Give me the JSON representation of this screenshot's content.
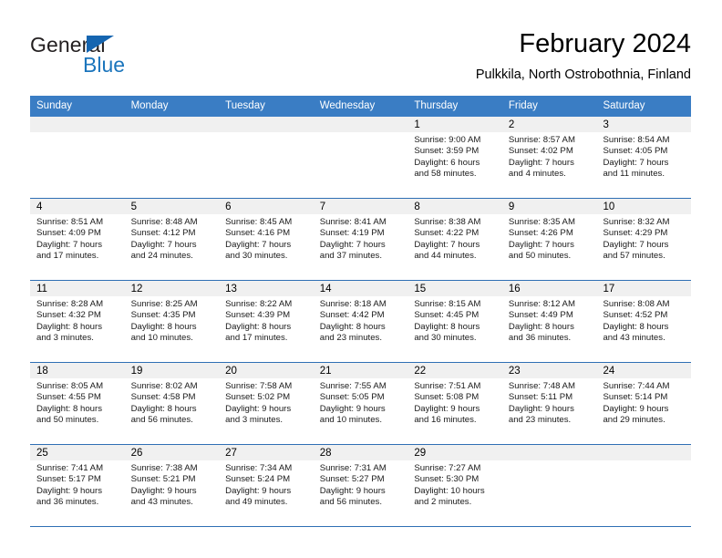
{
  "logo": {
    "word_general": "General",
    "word_blue": "Blue",
    "triangle_color": "#1565b0",
    "blue_color": "#1b75bc"
  },
  "header": {
    "month_title": "February 2024",
    "location": "Pulkkila, North Ostrobothnia, Finland"
  },
  "theme": {
    "header_row_bg": "#3a7dc4",
    "row_divider": "#2f6fb4",
    "daynum_band_bg": "#f0f0f0",
    "page_bg": "#ffffff",
    "text": "#000000"
  },
  "calendar": {
    "weekdays": [
      "Sunday",
      "Monday",
      "Tuesday",
      "Wednesday",
      "Thursday",
      "Friday",
      "Saturday"
    ],
    "weeks": [
      [
        {
          "day": "",
          "empty": true,
          "sunrise": "",
          "sunset": "",
          "daylight1": "",
          "daylight2": ""
        },
        {
          "day": "",
          "empty": true,
          "sunrise": "",
          "sunset": "",
          "daylight1": "",
          "daylight2": ""
        },
        {
          "day": "",
          "empty": true,
          "sunrise": "",
          "sunset": "",
          "daylight1": "",
          "daylight2": ""
        },
        {
          "day": "",
          "empty": true,
          "sunrise": "",
          "sunset": "",
          "daylight1": "",
          "daylight2": ""
        },
        {
          "day": "1",
          "sunrise": "Sunrise: 9:00 AM",
          "sunset": "Sunset: 3:59 PM",
          "daylight1": "Daylight: 6 hours",
          "daylight2": "and 58 minutes."
        },
        {
          "day": "2",
          "sunrise": "Sunrise: 8:57 AM",
          "sunset": "Sunset: 4:02 PM",
          "daylight1": "Daylight: 7 hours",
          "daylight2": "and 4 minutes."
        },
        {
          "day": "3",
          "sunrise": "Sunrise: 8:54 AM",
          "sunset": "Sunset: 4:05 PM",
          "daylight1": "Daylight: 7 hours",
          "daylight2": "and 11 minutes."
        }
      ],
      [
        {
          "day": "4",
          "sunrise": "Sunrise: 8:51 AM",
          "sunset": "Sunset: 4:09 PM",
          "daylight1": "Daylight: 7 hours",
          "daylight2": "and 17 minutes."
        },
        {
          "day": "5",
          "sunrise": "Sunrise: 8:48 AM",
          "sunset": "Sunset: 4:12 PM",
          "daylight1": "Daylight: 7 hours",
          "daylight2": "and 24 minutes."
        },
        {
          "day": "6",
          "sunrise": "Sunrise: 8:45 AM",
          "sunset": "Sunset: 4:16 PM",
          "daylight1": "Daylight: 7 hours",
          "daylight2": "and 30 minutes."
        },
        {
          "day": "7",
          "sunrise": "Sunrise: 8:41 AM",
          "sunset": "Sunset: 4:19 PM",
          "daylight1": "Daylight: 7 hours",
          "daylight2": "and 37 minutes."
        },
        {
          "day": "8",
          "sunrise": "Sunrise: 8:38 AM",
          "sunset": "Sunset: 4:22 PM",
          "daylight1": "Daylight: 7 hours",
          "daylight2": "and 44 minutes."
        },
        {
          "day": "9",
          "sunrise": "Sunrise: 8:35 AM",
          "sunset": "Sunset: 4:26 PM",
          "daylight1": "Daylight: 7 hours",
          "daylight2": "and 50 minutes."
        },
        {
          "day": "10",
          "sunrise": "Sunrise: 8:32 AM",
          "sunset": "Sunset: 4:29 PM",
          "daylight1": "Daylight: 7 hours",
          "daylight2": "and 57 minutes."
        }
      ],
      [
        {
          "day": "11",
          "sunrise": "Sunrise: 8:28 AM",
          "sunset": "Sunset: 4:32 PM",
          "daylight1": "Daylight: 8 hours",
          "daylight2": "and 3 minutes."
        },
        {
          "day": "12",
          "sunrise": "Sunrise: 8:25 AM",
          "sunset": "Sunset: 4:35 PM",
          "daylight1": "Daylight: 8 hours",
          "daylight2": "and 10 minutes."
        },
        {
          "day": "13",
          "sunrise": "Sunrise: 8:22 AM",
          "sunset": "Sunset: 4:39 PM",
          "daylight1": "Daylight: 8 hours",
          "daylight2": "and 17 minutes."
        },
        {
          "day": "14",
          "sunrise": "Sunrise: 8:18 AM",
          "sunset": "Sunset: 4:42 PM",
          "daylight1": "Daylight: 8 hours",
          "daylight2": "and 23 minutes."
        },
        {
          "day": "15",
          "sunrise": "Sunrise: 8:15 AM",
          "sunset": "Sunset: 4:45 PM",
          "daylight1": "Daylight: 8 hours",
          "daylight2": "and 30 minutes."
        },
        {
          "day": "16",
          "sunrise": "Sunrise: 8:12 AM",
          "sunset": "Sunset: 4:49 PM",
          "daylight1": "Daylight: 8 hours",
          "daylight2": "and 36 minutes."
        },
        {
          "day": "17",
          "sunrise": "Sunrise: 8:08 AM",
          "sunset": "Sunset: 4:52 PM",
          "daylight1": "Daylight: 8 hours",
          "daylight2": "and 43 minutes."
        }
      ],
      [
        {
          "day": "18",
          "sunrise": "Sunrise: 8:05 AM",
          "sunset": "Sunset: 4:55 PM",
          "daylight1": "Daylight: 8 hours",
          "daylight2": "and 50 minutes."
        },
        {
          "day": "19",
          "sunrise": "Sunrise: 8:02 AM",
          "sunset": "Sunset: 4:58 PM",
          "daylight1": "Daylight: 8 hours",
          "daylight2": "and 56 minutes."
        },
        {
          "day": "20",
          "sunrise": "Sunrise: 7:58 AM",
          "sunset": "Sunset: 5:02 PM",
          "daylight1": "Daylight: 9 hours",
          "daylight2": "and 3 minutes."
        },
        {
          "day": "21",
          "sunrise": "Sunrise: 7:55 AM",
          "sunset": "Sunset: 5:05 PM",
          "daylight1": "Daylight: 9 hours",
          "daylight2": "and 10 minutes."
        },
        {
          "day": "22",
          "sunrise": "Sunrise: 7:51 AM",
          "sunset": "Sunset: 5:08 PM",
          "daylight1": "Daylight: 9 hours",
          "daylight2": "and 16 minutes."
        },
        {
          "day": "23",
          "sunrise": "Sunrise: 7:48 AM",
          "sunset": "Sunset: 5:11 PM",
          "daylight1": "Daylight: 9 hours",
          "daylight2": "and 23 minutes."
        },
        {
          "day": "24",
          "sunrise": "Sunrise: 7:44 AM",
          "sunset": "Sunset: 5:14 PM",
          "daylight1": "Daylight: 9 hours",
          "daylight2": "and 29 minutes."
        }
      ],
      [
        {
          "day": "25",
          "sunrise": "Sunrise: 7:41 AM",
          "sunset": "Sunset: 5:17 PM",
          "daylight1": "Daylight: 9 hours",
          "daylight2": "and 36 minutes."
        },
        {
          "day": "26",
          "sunrise": "Sunrise: 7:38 AM",
          "sunset": "Sunset: 5:21 PM",
          "daylight1": "Daylight: 9 hours",
          "daylight2": "and 43 minutes."
        },
        {
          "day": "27",
          "sunrise": "Sunrise: 7:34 AM",
          "sunset": "Sunset: 5:24 PM",
          "daylight1": "Daylight: 9 hours",
          "daylight2": "and 49 minutes."
        },
        {
          "day": "28",
          "sunrise": "Sunrise: 7:31 AM",
          "sunset": "Sunset: 5:27 PM",
          "daylight1": "Daylight: 9 hours",
          "daylight2": "and 56 minutes."
        },
        {
          "day": "29",
          "sunrise": "Sunrise: 7:27 AM",
          "sunset": "Sunset: 5:30 PM",
          "daylight1": "Daylight: 10 hours",
          "daylight2": "and 2 minutes."
        },
        {
          "day": "",
          "empty": true,
          "sunrise": "",
          "sunset": "",
          "daylight1": "",
          "daylight2": ""
        },
        {
          "day": "",
          "empty": true,
          "sunrise": "",
          "sunset": "",
          "daylight1": "",
          "daylight2": ""
        }
      ]
    ]
  }
}
